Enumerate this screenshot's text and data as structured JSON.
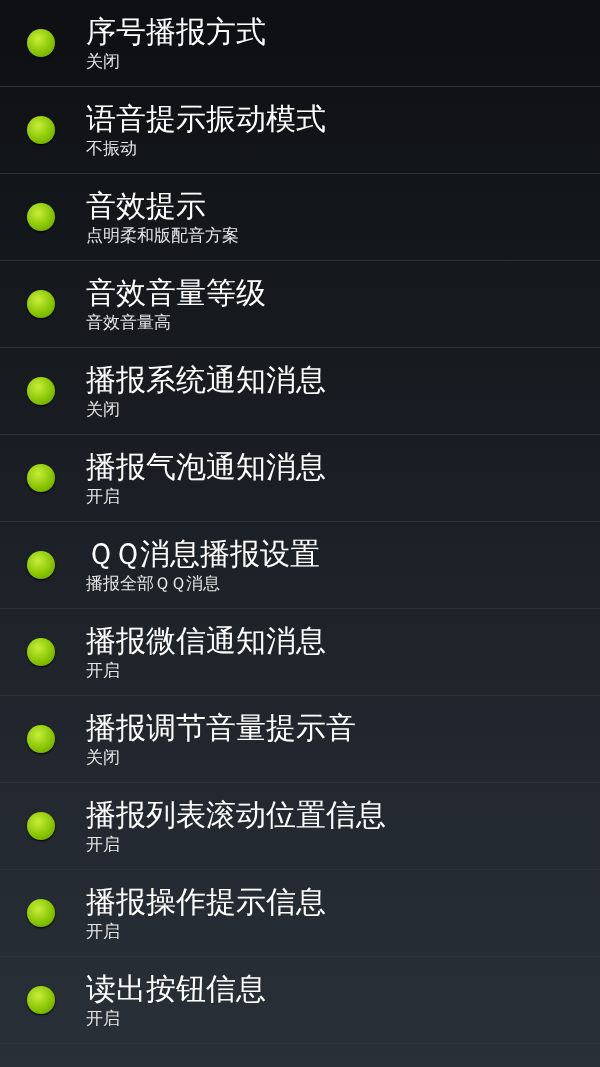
{
  "settings": [
    {
      "title": "序号播报方式",
      "value": "关闭"
    },
    {
      "title": "语音提示振动模式",
      "value": "不振动"
    },
    {
      "title": "音效提示",
      "value": "点明柔和版配音方案"
    },
    {
      "title": "音效音量等级",
      "value": "音效音量高"
    },
    {
      "title": "播报系统通知消息",
      "value": "关闭"
    },
    {
      "title": "播报气泡通知消息",
      "value": "开启"
    },
    {
      "title": "ＱＱ消息播报设置",
      "value": "播报全部ＱＱ消息"
    },
    {
      "title": "播报微信通知消息",
      "value": "开启"
    },
    {
      "title": "播报调节音量提示音",
      "value": "关闭"
    },
    {
      "title": "播报列表滚动位置信息",
      "value": "开启"
    },
    {
      "title": "播报操作提示信息",
      "value": "开启"
    },
    {
      "title": "读出按钮信息",
      "value": "开启"
    }
  ]
}
